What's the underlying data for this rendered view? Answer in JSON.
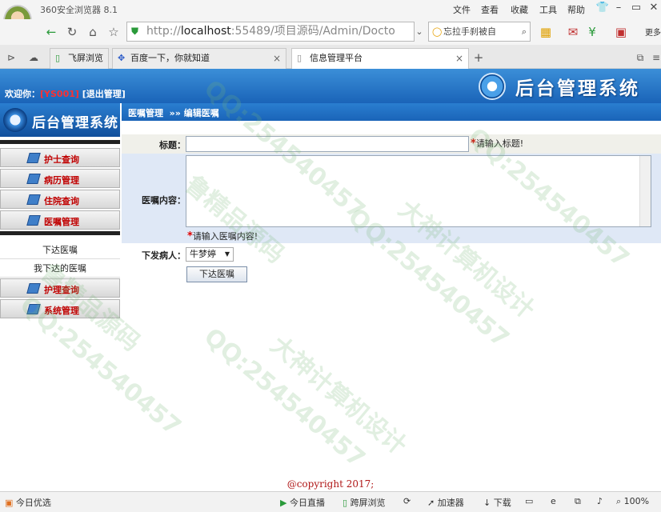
{
  "browser": {
    "app_name": "360安全浏览器 8.1",
    "menu": [
      "文件",
      "查看",
      "收藏",
      "工具",
      "帮助"
    ],
    "more_label": "更多",
    "zoom": "100%",
    "address": {
      "prefix": "http://",
      "host": "localhost",
      "rest": ":55489/项目源码/Admin/Docto"
    },
    "search_text": "忘拉手刹被自",
    "tabs": [
      {
        "label": "飞屏浏览",
        "active": false
      },
      {
        "label": "百度一下，你就知道",
        "active": false
      },
      {
        "label": "信息管理平台",
        "active": true
      }
    ],
    "status": {
      "today": "今日优选",
      "live": "今日直播",
      "screen": "跨屏浏览",
      "accelerator": "加速器",
      "download": "下载"
    }
  },
  "header": {
    "welcome_label": "欢迎你：",
    "user_id": "[YS001]",
    "logout_label": "[退出管理]",
    "system_title": "后台管理系统",
    "side_title": "后台管理系统"
  },
  "breadcrumb": {
    "section": "医嘱管理",
    "separator": "»»",
    "page": "编辑医嘱"
  },
  "sidebar": {
    "groups": [
      {
        "label": "护士查询"
      },
      {
        "label": "病历管理"
      },
      {
        "label": "住院查询"
      },
      {
        "label": "医嘱管理"
      }
    ],
    "sub_items": [
      {
        "label": "下达医嘱"
      },
      {
        "label": "我下达的医嘱"
      }
    ],
    "groups_after": [
      {
        "label": "护理查询"
      },
      {
        "label": "系统管理"
      }
    ]
  },
  "form": {
    "title_label": "标题：",
    "title_value": "",
    "title_required": "*",
    "title_tip": "请输入标题!",
    "content_label": "医嘱内容：",
    "content_value": "",
    "content_required": "*",
    "content_tip": "请输入医嘱内容!",
    "patient_label": "下发病人：",
    "patient_selected": "牛梦婷",
    "submit_label": "下达医嘱"
  },
  "footer": {
    "copyright": "@copyright 2017;"
  },
  "watermark": {
    "qq": "QQ:254540457",
    "studio": "大神计算机设计",
    "source": "鲁精品源码"
  },
  "colors": {
    "banner": "#1a64b8",
    "menu_label": "#c00000",
    "required": "#e00000",
    "copyright": "#b01818"
  }
}
